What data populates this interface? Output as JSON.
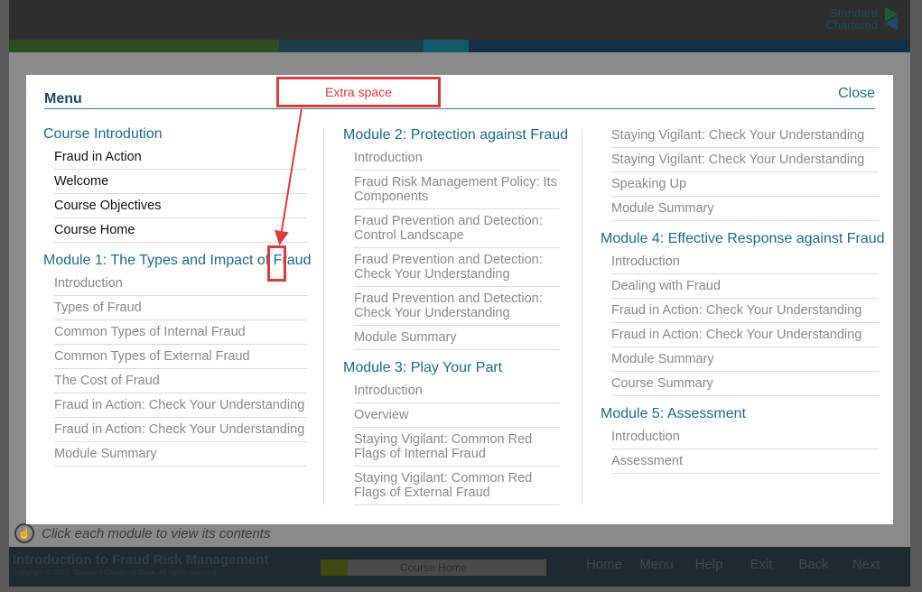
{
  "app": {
    "logo_line1": "Standard",
    "logo_line2": "Chartered",
    "hint_text": "Click each module to view its contents",
    "course_title": "Introduction to Fraud Risk Management",
    "copyright": "Copyright © 2017, Standard Chartered Bank. All rights reserved.",
    "progress_label": "Course Home",
    "progress_fraction": 0.12,
    "nav": [
      "Home",
      "Menu",
      "Help",
      "Exit",
      "Back",
      "Next"
    ],
    "colors": {
      "accent": "#1d6a8a",
      "annotation": "#e0393e",
      "rule": "#2a7a96"
    }
  },
  "modal": {
    "title": "Menu",
    "close_label": "Close",
    "columns": [
      {
        "modules": [
          {
            "heading": "Course Introdution",
            "items": [
              "Fraud in Action",
              "Welcome",
              "Course Objectives",
              "Course Home"
            ]
          },
          {
            "heading": "Module 1: The Types and Impact of  Fraud",
            "items": [
              "Introduction",
              "Types of Fraud",
              "Common Types of Internal Fraud",
              "Common Types of External Fraud",
              "The Cost of Fraud",
              "Fraud in Action: Check Your Understanding",
              "Fraud in Action: Check Your Understanding",
              "Module Summary"
            ]
          }
        ]
      },
      {
        "modules": [
          {
            "heading": "Module 2: Protection against Fraud",
            "items": [
              "Introduction",
              "Fraud Risk Management Policy: Its Components",
              "Fraud Prevention and Detection: Control Landscape",
              "Fraud Prevention and Detection: Check Your Understanding",
              "Fraud Prevention and Detection: Check Your Understanding",
              "Module Summary"
            ]
          },
          {
            "heading": "Module 3: Play Your Part",
            "items": [
              "Introduction",
              "Overview",
              "Staying Vigilant: Common Red Flags of Internal Fraud",
              "Staying Vigilant: Common Red Flags of External Fraud"
            ]
          }
        ]
      },
      {
        "modules": [
          {
            "heading": "",
            "items": [
              "Staying Vigilant: Check Your Understanding",
              "Staying Vigilant: Check Your Understanding",
              "Speaking Up",
              "Module Summary"
            ]
          },
          {
            "heading": "Module 4: Effective Response against Fraud",
            "items": [
              "Introduction",
              "Dealing with Fraud",
              "Fraud in Action: Check Your Understanding",
              "Fraud in Action: Check Your Understanding",
              "Module Summary",
              "Course Summary"
            ]
          },
          {
            "heading": "Module 5: Assessment",
            "items": [
              "Introduction",
              "Assessment"
            ]
          }
        ]
      }
    ]
  },
  "annotation": {
    "label": "Extra space"
  }
}
